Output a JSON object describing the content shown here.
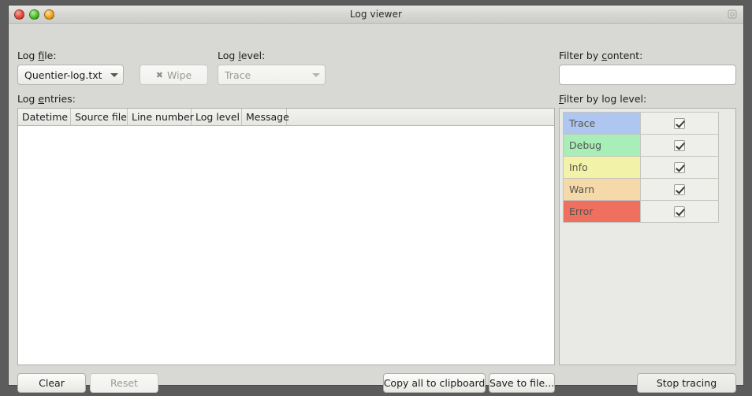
{
  "window": {
    "title": "Log viewer",
    "controls": [
      {
        "name": "close",
        "icon": "close-traffic-light"
      },
      {
        "name": "maximize",
        "icon": "maximize-traffic-light"
      },
      {
        "name": "minimize",
        "icon": "minimize-traffic-light"
      }
    ],
    "titlebar_icon": "app-menu-icon"
  },
  "left": {
    "log_file_label": "Log file:",
    "log_file_label_mnemonic": "f",
    "log_file_value": "Quentier-log.txt",
    "wipe_button": "Wipe",
    "wipe_icon": "cross-icon",
    "wipe_enabled": false,
    "log_level_label": "Log level:",
    "log_level_label_mnemonic": "l",
    "log_level_value": "Trace",
    "log_level_enabled": false,
    "log_entries_label": "Log entries:",
    "log_entries_label_mnemonic": "e"
  },
  "table": {
    "columns": [
      "Datetime",
      "Source file",
      "Line number",
      "Log level",
      "Message"
    ],
    "rows": []
  },
  "right": {
    "filter_content_label": "Filter by content:",
    "filter_content_label_mnemonic": "c",
    "filter_content_value": "",
    "filter_content_placeholder": "",
    "filter_level_label": "Filter by log level:",
    "filter_level_label_mnemonic": "F",
    "levels": [
      {
        "name": "Trace",
        "color": "#aec6f0",
        "checked": true
      },
      {
        "name": "Debug",
        "color": "#a8eeb8",
        "checked": true
      },
      {
        "name": "Info",
        "color": "#f2f2a8",
        "checked": true
      },
      {
        "name": "Warn",
        "color": "#f5d9a8",
        "checked": true
      },
      {
        "name": "Error",
        "color": "#f07060",
        "checked": true
      }
    ]
  },
  "footer": {
    "clear_button": "Clear",
    "clear_enabled": true,
    "reset_button": "Reset",
    "reset_enabled": false,
    "copy_button": "Copy all to clipboard",
    "save_button": "Save to file...",
    "trace_button": "Stop tracing"
  }
}
